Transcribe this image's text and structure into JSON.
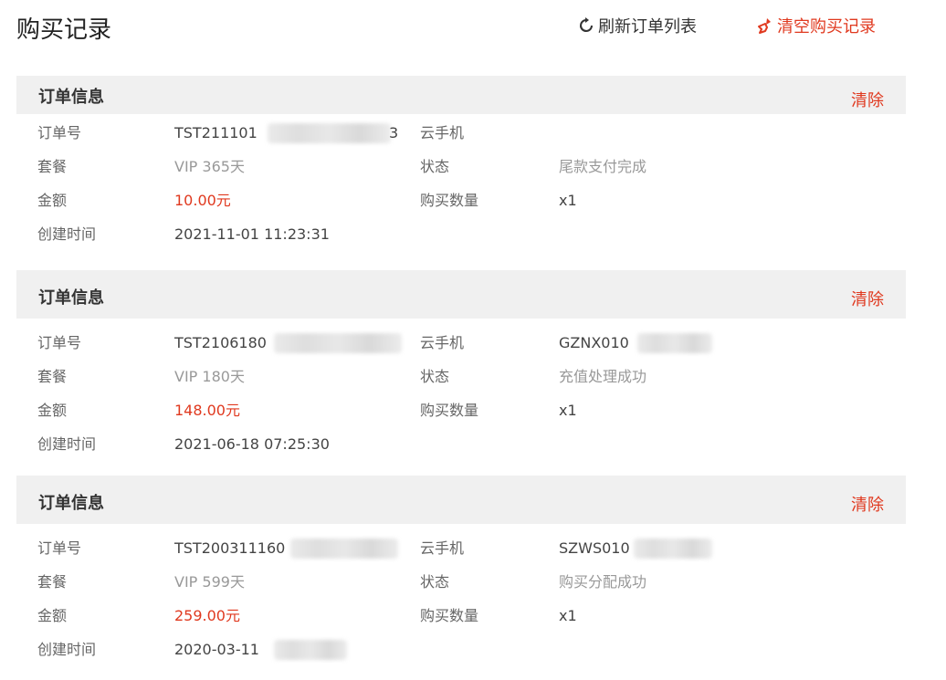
{
  "header": {
    "title": "购买记录",
    "refresh_label": "刷新订单列表",
    "clear_all_label": "清空购买记录"
  },
  "labels": {
    "section_title": "订单信息",
    "delete": "清除",
    "order_no": "订单号",
    "package": "套餐",
    "amount": "金额",
    "created_at": "创建时间",
    "cloud_phone": "云手机",
    "status": "状态",
    "quantity": "购买数量"
  },
  "orders": [
    {
      "order_no": "TST211101",
      "order_no_tail": "3",
      "package": "VIP 365天",
      "amount": "10.00元",
      "created_at": "2021-11-01 11:23:31",
      "cloud_phone": "",
      "status": "尾款支付完成",
      "quantity": "x1"
    },
    {
      "order_no": "TST2106180",
      "package": "VIP 180天",
      "amount": "148.00元",
      "created_at": "2021-06-18 07:25:30",
      "cloud_phone": "GZNX010",
      "status": "充值处理成功",
      "quantity": "x1"
    },
    {
      "order_no": "TST200311160",
      "package": "VIP 599天",
      "amount": "259.00元",
      "created_at": "2020-03-11",
      "cloud_phone": "SZWS010",
      "status": "购买分配成功",
      "quantity": "x1"
    }
  ],
  "colors": {
    "accent": "#e0391f",
    "header_bg": "#f0f0f0",
    "label": "#666666",
    "muted": "#999999"
  }
}
